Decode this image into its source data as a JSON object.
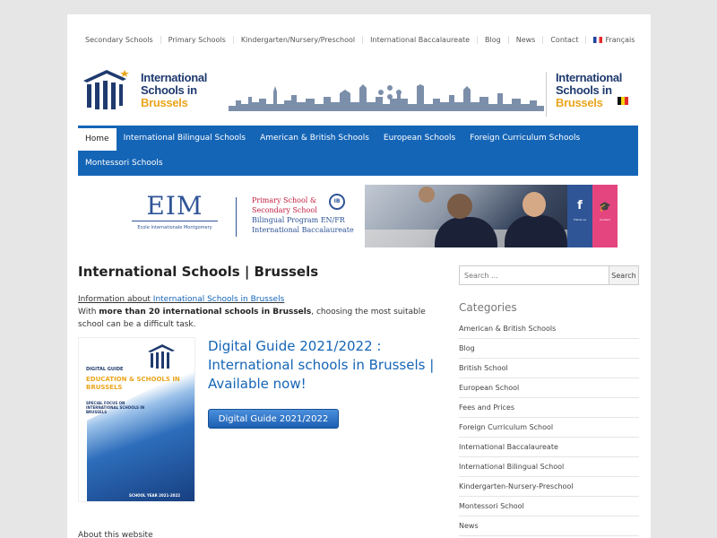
{
  "topnav": {
    "items": [
      "Secondary Schools",
      "Primary Schools",
      "Kindergarten/Nursery/Preschool",
      "International Baccalaureate",
      "Blog",
      "News",
      "Contact",
      "Français"
    ]
  },
  "header": {
    "logo_line1": "International",
    "logo_line2": "Schools in",
    "logo_line3": "Brussels"
  },
  "mainnav": {
    "row1": [
      "Home",
      "International Bilingual Schools",
      "American & British Schools",
      "European Schools",
      "Foreign Curriculum Schools"
    ],
    "row2": [
      "Montessori Schools"
    ],
    "active_color": "#ffffff",
    "bar_color": "#1565b6"
  },
  "banner": {
    "eim": "EIM",
    "eim_sub": "Ecole Internationale Montgomery",
    "line1": "Primary School &",
    "line2": "Secondary School",
    "line3": "Bilingual Program EN/FR",
    "line4": "International Baccalaureate",
    "ib": "IB"
  },
  "content": {
    "title": "International Schools | Brussels",
    "info_prefix": "Information about ",
    "info_link": "International Schools in Brussels",
    "par_pre": "With ",
    "par_bold": "more than 20 international schools in Brussels",
    "par_post": ", choosing the most suitable school can be a difficult task.",
    "cover_cap1": "DIGITAL GUIDE",
    "cover_cap2": "EDUCATION & SCHOOLS IN BRUSSELS",
    "cover_cap3": "SPECIAL FOCUS ON INTERNATIONAL SCHOOLS IN BRUSSELS",
    "cover_cap4": "SCHOOL YEAR 2021-2022",
    "guide_title": "Digital Guide 2021/2022 : International schools in Brussels | Available now!",
    "guide_button": "Digital Guide 2021/2022",
    "about": "About this website"
  },
  "sidebar": {
    "search_placeholder": "Search ...",
    "search_button": "Search",
    "categories_title": "Categories",
    "categories": [
      "American & British Schools",
      "Blog",
      "British School",
      "European School",
      "Fees and Prices",
      "Foreign Curriculum School",
      "International Baccalaureate",
      "International Bilingual School",
      "Kindergarten-Nursery-Preschool",
      "Montessori School",
      "News"
    ]
  }
}
